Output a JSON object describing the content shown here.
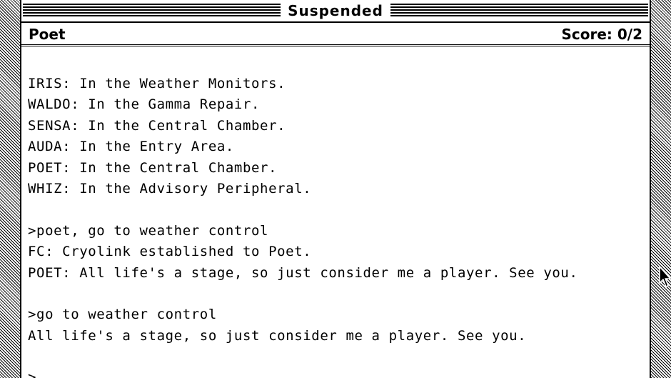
{
  "window": {
    "title": "Suspended"
  },
  "status": {
    "location": "Poet",
    "score": "Score: 0/2"
  },
  "transcript": {
    "lines": [
      "IRIS: In the Weather Monitors.",
      "WALDO: In the Gamma Repair.",
      "SENSA: In the Central Chamber.",
      "AUDA: In the Entry Area.",
      "POET: In the Central Chamber.",
      "WHIZ: In the Advisory Peripheral.",
      "",
      ">poet, go to weather control",
      "FC: Cryolink established to Poet.",
      "POET: All life's a stage, so just consider me a player. See you.",
      "",
      ">go to weather control",
      "All life's a stage, so just consider me a player. See you.",
      "",
      ">"
    ]
  },
  "icons": {
    "mouse_pointer": "arrow-cursor-icon"
  }
}
